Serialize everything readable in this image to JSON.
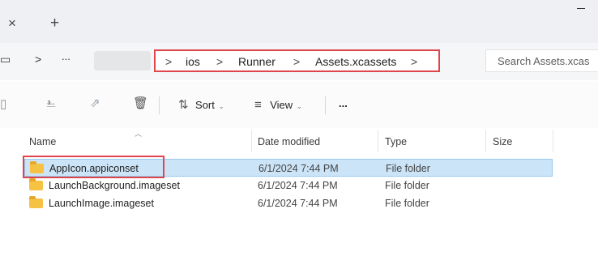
{
  "tabs": {
    "close_glyph": "×",
    "new_tab_glyph": "+"
  },
  "address_bar": {
    "crumbs": [
      "ios",
      "Runner",
      "Assets.xcassets"
    ],
    "separator": ">",
    "overflow": "...",
    "search_placeholder": "Search Assets.xcas"
  },
  "toolbar": {
    "sort_label": "Sort",
    "view_label": "View",
    "more": "..."
  },
  "columns": {
    "name": "Name",
    "date_modified": "Date modified",
    "type": "Type",
    "size": "Size"
  },
  "files": [
    {
      "name": "AppIcon.appiconset",
      "date": "6/1/2024 7:44 PM",
      "type": "File folder",
      "selected": true
    },
    {
      "name": "LaunchBackground.imageset",
      "date": "6/1/2024 7:44 PM",
      "type": "File folder",
      "selected": false
    },
    {
      "name": "LaunchImage.imageset",
      "date": "6/1/2024 7:44 PM",
      "type": "File folder",
      "selected": false
    }
  ],
  "colors": {
    "accent_outline": "#e0454c",
    "selection": "#cce4f7",
    "folder": "#f6c243"
  }
}
